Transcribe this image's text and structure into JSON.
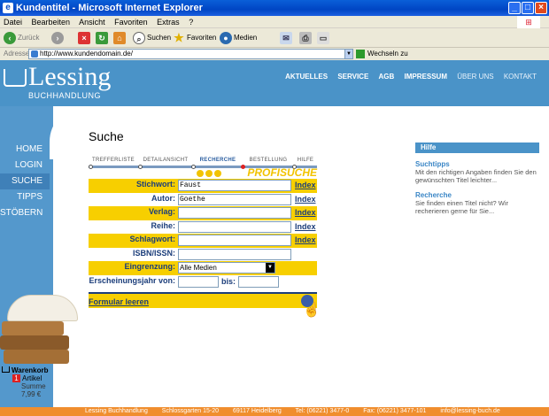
{
  "window": {
    "title": "Kundentitel - Microsoft Internet Explorer"
  },
  "menu": [
    "Datei",
    "Bearbeiten",
    "Ansicht",
    "Favoriten",
    "Extras",
    "?"
  ],
  "toolbar": {
    "back": "Zurück",
    "search": "Suchen",
    "favorites": "Favoriten",
    "media": "Medien"
  },
  "address": {
    "label": "Adresse",
    "url": "http://www.kundendomain.de/",
    "go": "Wechseln zu"
  },
  "site": {
    "logo_name": "Lessing",
    "logo_sub": "BUCHHANDLUNG",
    "topnav": [
      "AKTUELLES",
      "SERVICE",
      "AGB",
      "IMPRESSUM",
      "ÜBER UNS",
      "KONTAKT"
    ],
    "leftnav": [
      "HOME",
      "LOGIN",
      "SUCHE",
      "TIPPS",
      "STÖBERN"
    ],
    "leftnav_active": "SUCHE"
  },
  "main": {
    "title": "Suche",
    "tabs": [
      "TREFFERLISTE",
      "DETAILANSICHT",
      "RECHERCHE",
      "BESTELLUNG",
      "HILFE"
    ],
    "active_tab": "RECHERCHE",
    "profi_label": "PROFISUCHE",
    "index_label": "Index",
    "fields": {
      "stichwort": {
        "label": "Stichwort:",
        "value": "Faust"
      },
      "autor": {
        "label": "Autor:",
        "value": "Goethe"
      },
      "verlag": {
        "label": "Verlag:",
        "value": ""
      },
      "reihe": {
        "label": "Reihe:",
        "value": ""
      },
      "schlagwort": {
        "label": "Schlagwort:",
        "value": ""
      },
      "isbn": {
        "label": "ISBN/ISSN:",
        "value": ""
      },
      "eingrenzung": {
        "label": "Eingrenzung:",
        "value": "Alle Medien"
      },
      "jahr_von": {
        "label": "Erscheinungsjahr von:",
        "value": ""
      },
      "jahr_bis": {
        "label": "bis:",
        "value": ""
      }
    },
    "reset_link": "Formular leeren"
  },
  "help": {
    "header": "Hilfe",
    "items": [
      {
        "title": "Suchtipps",
        "text": "Mit den richtigen Angaben finden Sie den gewünschten Titel leichter..."
      },
      {
        "title": "Recherche",
        "text": "Sie finden einen Titel nicht? Wir recherieren gerne für Sie..."
      }
    ]
  },
  "cart": {
    "title": "Warenkorb",
    "count": "1",
    "items_label": "Artikel",
    "sum_label": "Summe",
    "sum_value": "7,99 €"
  },
  "footer": [
    "Lessing Buchhandlung",
    "Schlossgarten 15-20",
    "69117 Heidelberg",
    "Tel: (06221) 3477-0",
    "Fax: (06221) 3477-101",
    "info@lessing-buch.de"
  ]
}
